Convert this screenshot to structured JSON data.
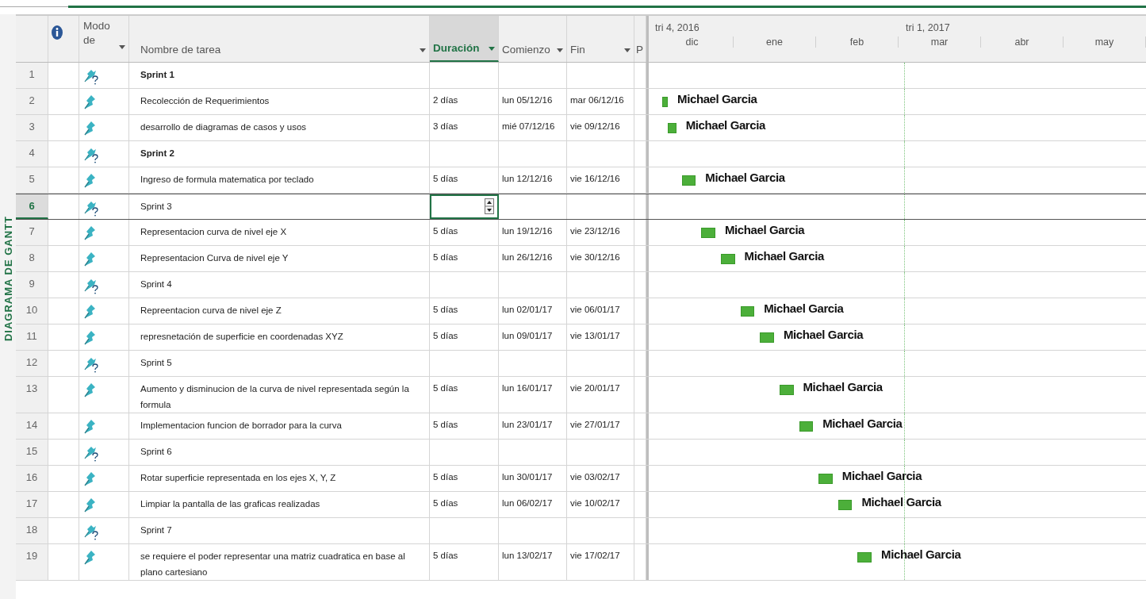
{
  "view_label": "DIAGRAMA DE GANTT",
  "columns": {
    "mode": "Modo de",
    "name": "Nombre de tarea",
    "duration": "Duración",
    "start": "Comienzo",
    "finish": "Fin",
    "next": "P"
  },
  "timescale": {
    "quarters": [
      {
        "label": "tri 4, 2016"
      },
      {
        "label": "tri 1, 2017"
      }
    ],
    "months": [
      "dic",
      "ene",
      "feb",
      "mar",
      "abr",
      "may"
    ]
  },
  "tasks": [
    {
      "id": "1",
      "kind": "pin-question",
      "name": "Sprint 1",
      "bold": true,
      "selected": false,
      "editing": false
    },
    {
      "id": "2",
      "kind": "pin",
      "name": "Recolección de Requerimientos",
      "bold": false,
      "duration": "2 días",
      "start": "lun 05/12/16",
      "finish": "mar 06/12/16",
      "resource": "Michael Garcia",
      "selected": false,
      "editing": false
    },
    {
      "id": "3",
      "kind": "pin",
      "name": "desarrollo de diagramas de casos y usos",
      "bold": false,
      "duration": "3 días",
      "start": "mié 07/12/16",
      "finish": "vie 09/12/16",
      "resource": "Michael Garcia",
      "selected": false,
      "editing": false
    },
    {
      "id": "4",
      "kind": "pin-question",
      "name": "Sprint 2",
      "bold": true,
      "selected": false,
      "editing": false
    },
    {
      "id": "5",
      "kind": "pin",
      "name": "Ingreso de formula matematica por teclado",
      "bold": false,
      "duration": "5 días",
      "start": "lun 12/12/16",
      "finish": "vie 16/12/16",
      "resource": "Michael Garcia",
      "selected": false,
      "editing": false
    },
    {
      "id": "6",
      "kind": "pin-question",
      "name": "Sprint 3",
      "bold": false,
      "selected": true,
      "editing": true
    },
    {
      "id": "7",
      "kind": "pin",
      "name": "Representacion curva de nivel eje X",
      "bold": false,
      "duration": "5 días",
      "start": "lun 19/12/16",
      "finish": "vie 23/12/16",
      "resource": "Michael Garcia",
      "selected": false,
      "editing": false
    },
    {
      "id": "8",
      "kind": "pin",
      "name": "Representacion Curva de nivel eje Y",
      "bold": false,
      "duration": "5 días",
      "start": "lun 26/12/16",
      "finish": "vie 30/12/16",
      "resource": "Michael Garcia",
      "selected": false,
      "editing": false
    },
    {
      "id": "9",
      "kind": "pin-question",
      "name": "Sprint 4",
      "bold": false,
      "selected": false,
      "editing": false
    },
    {
      "id": "10",
      "kind": "pin",
      "name": "Repreentacion curva de nivel eje Z",
      "bold": false,
      "duration": "5 días",
      "start": "lun 02/01/17",
      "finish": "vie 06/01/17",
      "resource": "Michael Garcia",
      "selected": false,
      "editing": false
    },
    {
      "id": "11",
      "kind": "pin",
      "name": "represnetación de superficie en coordenadas XYZ",
      "bold": false,
      "duration": "5 días",
      "start": "lun 09/01/17",
      "finish": "vie 13/01/17",
      "resource": "Michael Garcia",
      "selected": false,
      "editing": false
    },
    {
      "id": "12",
      "kind": "pin-question",
      "name": "Sprint 5",
      "bold": false,
      "selected": false,
      "editing": false
    },
    {
      "id": "13",
      "kind": "pin",
      "name": "Aumento y disminucion de la curva de nivel representada según la formula",
      "bold": false,
      "duration": "5 días",
      "start": "lun 16/01/17",
      "finish": "vie 20/01/17",
      "resource": "Michael Garcia",
      "selected": false,
      "editing": false
    },
    {
      "id": "14",
      "kind": "pin",
      "name": "Implementacion funcion de borrador para la curva",
      "bold": false,
      "duration": "5 días",
      "start": "lun 23/01/17",
      "finish": "vie 27/01/17",
      "resource": "Michael Garcia",
      "selected": false,
      "editing": false
    },
    {
      "id": "15",
      "kind": "pin-question",
      "name": "Sprint 6",
      "bold": false,
      "selected": false,
      "editing": false
    },
    {
      "id": "16",
      "kind": "pin",
      "name": "Rotar superficie representada en los ejes X, Y, Z",
      "bold": false,
      "duration": "5 días",
      "start": "lun 30/01/17",
      "finish": "vie 03/02/17",
      "resource": "Michael Garcia",
      "selected": false,
      "editing": false
    },
    {
      "id": "17",
      "kind": "pin",
      "name": "Limpiar la pantalla de las graficas realizadas",
      "bold": false,
      "duration": "5 días",
      "start": "lun 06/02/17",
      "finish": "vie 10/02/17",
      "resource": "Michael Garcia",
      "selected": false,
      "editing": false
    },
    {
      "id": "18",
      "kind": "pin-question",
      "name": "Sprint 7",
      "bold": false,
      "selected": false,
      "editing": false
    },
    {
      "id": "19",
      "kind": "pin",
      "name": "se requiere el poder representar una matriz cuadratica en base al plano cartesiano",
      "bold": false,
      "duration": "5 días",
      "start": "lun 13/02/17",
      "finish": "vie 17/02/17",
      "resource": "Michael Garcia",
      "selected": false,
      "editing": false
    }
  ]
}
